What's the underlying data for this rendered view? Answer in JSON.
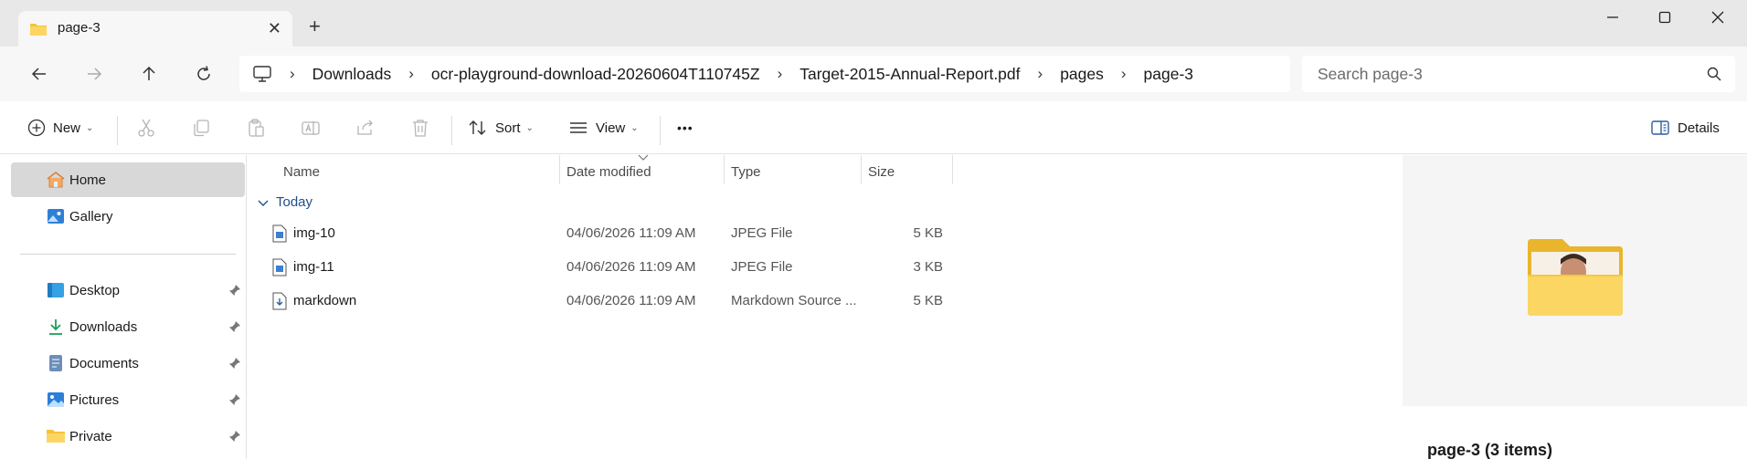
{
  "window": {
    "tab_title": "page-3",
    "tab_icon": "folder-icon",
    "new_tab_glyph": "+",
    "close_tab_glyph": "✕"
  },
  "address": {
    "crumbs": [
      "Downloads",
      "ocr-playground-download-20260604T110745Z",
      "Target-2015-Annual-Report.pdf",
      "pages",
      "page-3"
    ],
    "search_placeholder": "Search page-3"
  },
  "commands": {
    "new_label": "New",
    "sort_label": "Sort",
    "view_label": "View",
    "more_glyph": "•••",
    "details_label": "Details"
  },
  "sidebar": {
    "items": [
      {
        "label": "Home",
        "icon": "home-icon",
        "selected": true
      },
      {
        "label": "Gallery",
        "icon": "gallery-icon"
      },
      {
        "label": "Desktop",
        "icon": "desktop-icon",
        "pinned": true
      },
      {
        "label": "Downloads",
        "icon": "download-icon",
        "pinned": true
      },
      {
        "label": "Documents",
        "icon": "documents-icon",
        "pinned": true
      },
      {
        "label": "Pictures",
        "icon": "pictures-icon",
        "pinned": true
      },
      {
        "label": "Private",
        "icon": "folder-icon",
        "pinned": true
      }
    ]
  },
  "filelist": {
    "columns": {
      "name": "Name",
      "date": "Date modified",
      "type": "Type",
      "size": "Size"
    },
    "group": "Today",
    "rows": [
      {
        "name": "img-10",
        "date": "04/06/2026 11:09 AM",
        "type": "JPEG File",
        "size": "5 KB",
        "icon": "jpeg-file-icon"
      },
      {
        "name": "img-11",
        "date": "04/06/2026 11:09 AM",
        "type": "JPEG File",
        "size": "3 KB",
        "icon": "jpeg-file-icon"
      },
      {
        "name": "markdown",
        "date": "04/06/2026 11:09 AM",
        "type": "Markdown Source ...",
        "size": "5 KB",
        "icon": "markdown-file-icon"
      }
    ]
  },
  "details": {
    "title": "page-3 (3 items)"
  },
  "colors": {
    "accent": "#1f4e8c",
    "folder": "#f5c33b",
    "selected_bg": "#d8d8d8"
  }
}
